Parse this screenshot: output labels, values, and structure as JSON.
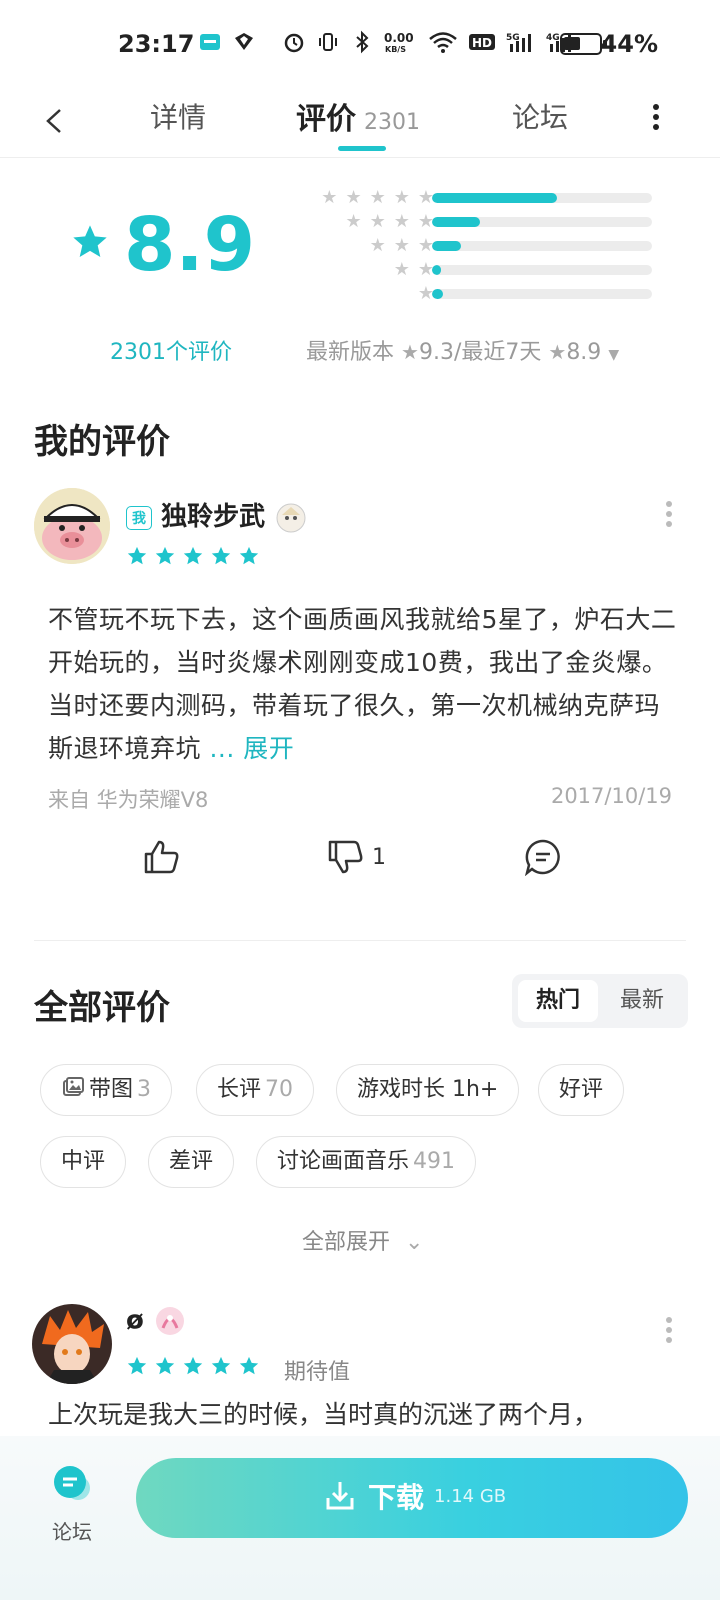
{
  "status_bar": {
    "time": "23:17",
    "net_speed": "0.00\nKB/S",
    "battery": "44%",
    "icons": [
      "taptap-icon",
      "app-icon",
      "alarm-icon",
      "vibrate-icon",
      "bluetooth-icon",
      "wifi-icon",
      "hd-icon",
      "5g-signal-icon",
      "4g-signal-icon",
      "battery-icon"
    ]
  },
  "nav": {
    "tabs": [
      {
        "label": "详情"
      },
      {
        "label": "评价",
        "count": "2301"
      },
      {
        "label": "论坛"
      }
    ],
    "active_tab": "评价"
  },
  "rating": {
    "score": "8.9",
    "count_label": "2301个评价",
    "distribution": [
      {
        "stars": 5,
        "fraction": 0.57
      },
      {
        "stars": 4,
        "fraction": 0.22
      },
      {
        "stars": 3,
        "fraction": 0.13
      },
      {
        "stars": 2,
        "fraction": 0.04
      },
      {
        "stars": 1,
        "fraction": 0.05
      }
    ],
    "latest_version_label": "最新版本",
    "latest_version_score": "9.3",
    "separator": "/",
    "recent_label": "最近7天",
    "recent_score": "8.9",
    "accent": "#1fc4cc"
  },
  "my_review": {
    "heading": "我的评价",
    "badge": "我",
    "username": "独聆步武",
    "stars": 5,
    "text": "不管玩不玩下去，这个画质画风我就给5星了，炉石大二开始玩的，当时炎爆术刚刚变成10费，我出了金炎爆。当时还要内测码，带着玩了很久，第一次机械纳克萨玛斯退环境弃坑",
    "expand": "... 展开",
    "device": "来自 华为荣耀V8",
    "date": "2017/10/19",
    "dislike_count": "1"
  },
  "all_reviews": {
    "heading": "全部评价",
    "sort": {
      "options": [
        "热门",
        "最新"
      ],
      "selected": "热门"
    },
    "filters": [
      {
        "label": "带图",
        "count": "3",
        "icon": "image-icon"
      },
      {
        "label": "长评",
        "count": "70"
      },
      {
        "label": "游戏时长 1h+"
      },
      {
        "label": "好评"
      },
      {
        "label": "中评"
      },
      {
        "label": "差评"
      },
      {
        "label": "讨论画面音乐",
        "count": "491"
      }
    ],
    "expand_all": "全部展开"
  },
  "second_review": {
    "username": "ø",
    "stars": 5,
    "tag": "期待值",
    "text_preview": "上次玩是我大三的时候，当时真的沉迷了两个月，"
  },
  "bottom_bar": {
    "forum_label": "论坛",
    "download_label": "下载",
    "download_size": "1.14 GB"
  }
}
